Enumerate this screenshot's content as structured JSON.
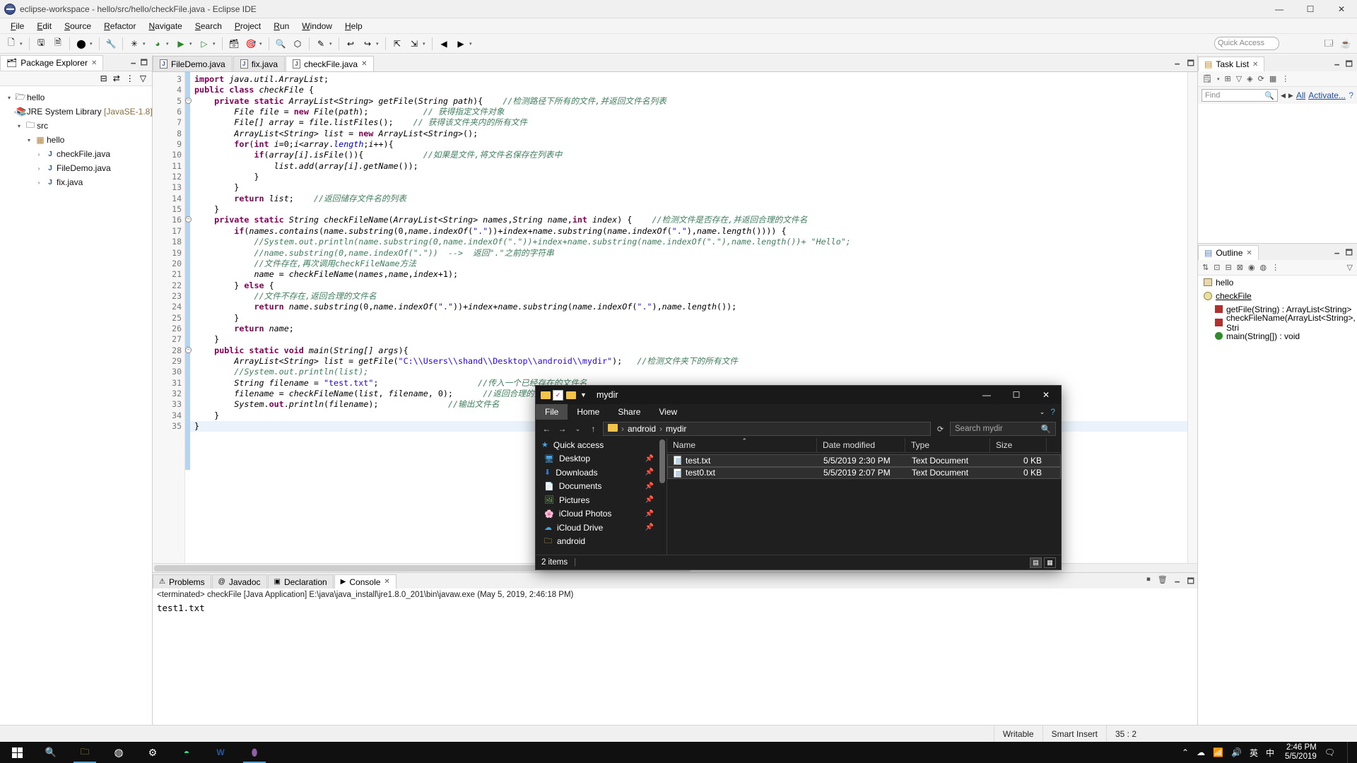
{
  "window": {
    "title": "eclipse-workspace - hello/src/hello/checkFile.java - Eclipse IDE",
    "minimize": "—",
    "maximize": "☐",
    "close": "✕"
  },
  "menubar": {
    "items": [
      "File",
      "Edit",
      "Source",
      "Refactor",
      "Navigate",
      "Search",
      "Project",
      "Run",
      "Window",
      "Help"
    ]
  },
  "toolbar": {
    "quick_access_placeholder": "Quick Access"
  },
  "package_explorer": {
    "title": "Package Explorer",
    "tree": [
      {
        "indent": 0,
        "twist": "▾",
        "icon": "project-icon",
        "label": "hello",
        "dim": ""
      },
      {
        "indent": 1,
        "twist": "›",
        "icon": "library-icon",
        "label": "JRE System Library",
        "dim": " [JavaSE-1.8]"
      },
      {
        "indent": 1,
        "twist": "▾",
        "icon": "source-folder-icon",
        "label": "src",
        "dim": ""
      },
      {
        "indent": 2,
        "twist": "▾",
        "icon": "package-icon",
        "label": "hello",
        "dim": ""
      },
      {
        "indent": 3,
        "twist": "›",
        "icon": "java-file-icon",
        "label": "checkFile.java",
        "dim": ""
      },
      {
        "indent": 3,
        "twist": "›",
        "icon": "java-file-icon",
        "label": "FileDemo.java",
        "dim": ""
      },
      {
        "indent": 3,
        "twist": "›",
        "icon": "java-file-icon",
        "label": "fix.java",
        "dim": ""
      }
    ]
  },
  "editor": {
    "tabs": [
      {
        "label": "FileDemo.java",
        "active": false,
        "closable": false
      },
      {
        "label": "fix.java",
        "active": false,
        "closable": false
      },
      {
        "label": "checkFile.java",
        "active": true,
        "closable": true
      }
    ],
    "first_line": 3,
    "last_line": 35,
    "lines": [
      {
        "n": 3,
        "fold": false,
        "html": "<span class=\"kw\">import</span> <span class=\"ty\">java.util.ArrayList</span>;"
      },
      {
        "n": 4,
        "fold": false,
        "html": "<span class=\"kw\">public class</span> <span class=\"ty\">checkFile</span> {"
      },
      {
        "n": 5,
        "fold": true,
        "html": "    <span class=\"kw\">private static</span> <span class=\"ty\">ArrayList&lt;String&gt; getFile</span>(<span class=\"ty\">String path</span>){    <span class=\"cmt\">//检测路径下所有的文件,并返回文件名列表</span>"
      },
      {
        "n": 6,
        "fold": false,
        "html": "        <span class=\"ty\">File file</span> = <span class=\"kw\">new</span> <span class=\"ty\">File</span>(<span class=\"id\">path</span>);           <span class=\"cmt\">// 获得指定文件对象</span>"
      },
      {
        "n": 7,
        "fold": false,
        "html": "        <span class=\"ty\">File[] array</span> = <span class=\"ty\">file.listFiles</span>();    <span class=\"cmt\">// 获得该文件夹内的所有文件</span>"
      },
      {
        "n": 8,
        "fold": false,
        "html": "        <span class=\"ty\">ArrayList&lt;String&gt; list</span> = <span class=\"kw\">new</span> <span class=\"ty\">ArrayList&lt;String&gt;</span>();"
      },
      {
        "n": 9,
        "fold": false,
        "html": "        <span class=\"kw\">for</span>(<span class=\"kw\">int</span> <span class=\"ty\">i</span>=0;<span class=\"ty\">i</span>&lt;<span class=\"ty\">array</span>.<span class=\"fld\">length</span>;<span class=\"ty\">i</span>++){"
      },
      {
        "n": 10,
        "fold": false,
        "html": "            <span class=\"kw\">if</span>(<span class=\"ty\">array[i].isFile</span>()){            <span class=\"cmt\">//如果是文件,将文件名保存在列表中</span>"
      },
      {
        "n": 11,
        "fold": false,
        "html": "                <span class=\"ty\">list.add</span>(<span class=\"ty\">array[i].getName</span>());"
      },
      {
        "n": 12,
        "fold": false,
        "html": "            }"
      },
      {
        "n": 13,
        "fold": false,
        "html": "        }"
      },
      {
        "n": 14,
        "fold": false,
        "html": "        <span class=\"kw\">return</span> <span class=\"ty\">list</span>;    <span class=\"cmt\">//返回储存文件名的列表</span>"
      },
      {
        "n": 15,
        "fold": false,
        "html": "    }"
      },
      {
        "n": 16,
        "fold": true,
        "html": "    <span class=\"kw\">private static</span> <span class=\"ty\">String checkFileName</span>(<span class=\"ty\">ArrayList&lt;String&gt; names</span>,<span class=\"ty\">String name</span>,<span class=\"kw\">int</span> <span class=\"ty\">index</span>) {    <span class=\"cmt\">//检测文件是否存在,并返回合理的文件名</span>"
      },
      {
        "n": 17,
        "fold": false,
        "html": "        <span class=\"kw\">if</span>(<span class=\"ty\">names.contains</span>(<span class=\"ty\">name.substring</span>(0,<span class=\"ty\">name.indexOf</span>(<span class=\"str\">\".\"</span>))+<span class=\"ty\">index</span>+<span class=\"ty\">name.substring</span>(<span class=\"ty\">name.indexOf</span>(<span class=\"str\">\".\"</span>),<span class=\"ty\">name.length</span>()))) {"
      },
      {
        "n": 18,
        "fold": false,
        "html": "            <span class=\"cmt\">//System.out.println(name.substring(0,name.indexOf(\".\"))+index+name.substring(name.indexOf(\".\"),name.length())+ \"Hello\";</span>"
      },
      {
        "n": 19,
        "fold": false,
        "html": "            <span class=\"cmt\">//name.substring(0,name.indexOf(\".\"))  --&gt;  返回\".\"之前的字符串</span>"
      },
      {
        "n": 20,
        "fold": false,
        "html": "            <span class=\"cmt\">//文件存在,再次调用checkFileName方法</span>"
      },
      {
        "n": 21,
        "fold": false,
        "html": "            <span class=\"ty\">name</span> = <span class=\"ty\">checkFileName</span>(<span class=\"ty\">names</span>,<span class=\"ty\">name</span>,<span class=\"ty\">index</span>+1);"
      },
      {
        "n": 22,
        "fold": false,
        "html": "        } <span class=\"kw\">else</span> {"
      },
      {
        "n": 23,
        "fold": false,
        "html": "            <span class=\"cmt\">//文件不存在,返回合理的文件名</span>"
      },
      {
        "n": 24,
        "fold": false,
        "html": "            <span class=\"kw\">return</span> <span class=\"ty\">name.substring</span>(0,<span class=\"ty\">name.indexOf</span>(<span class=\"str\">\".\"</span>))+<span class=\"ty\">index</span>+<span class=\"ty\">name.substring</span>(<span class=\"ty\">name.indexOf</span>(<span class=\"str\">\".\"</span>),<span class=\"ty\">name.length</span>());"
      },
      {
        "n": 25,
        "fold": false,
        "html": "        }"
      },
      {
        "n": 26,
        "fold": false,
        "html": "        <span class=\"kw\">return</span> <span class=\"ty\">name</span>;"
      },
      {
        "n": 27,
        "fold": false,
        "html": "    }"
      },
      {
        "n": 28,
        "fold": true,
        "html": "    <span class=\"kw\">public static void</span> <span class=\"ty\">main</span>(<span class=\"ty\">String[] args</span>){"
      },
      {
        "n": 29,
        "fold": false,
        "html": "        <span class=\"ty\">ArrayList&lt;String&gt; list</span> = <span class=\"ty\">getFile</span>(<span class=\"str\">\"C:\\\\Users\\\\shand\\\\Desktop\\\\android\\\\mydir\"</span>);   <span class=\"cmt\">//检测文件夹下的所有文件</span>"
      },
      {
        "n": 30,
        "fold": false,
        "html": "        <span class=\"cmt\">//System.out.println(list);</span>"
      },
      {
        "n": 31,
        "fold": false,
        "html": "        <span class=\"ty\">String filename</span> = <span class=\"str\">\"test.txt\"</span>;                    <span class=\"cmt\">//传入一个已经存在的文件名</span>"
      },
      {
        "n": 32,
        "fold": false,
        "html": "        <span class=\"ty\">filename</span> = <span class=\"ty\">checkFileName</span>(<span class=\"ty\">list</span>, <span class=\"ty\">filename</span>, 0);      <span class=\"cmt\">//返回合理的文件名</span>"
      },
      {
        "n": 33,
        "fold": false,
        "html": "        <span class=\"ty\">System</span>.<span class=\"kw\">out</span>.<span class=\"ty\">println</span>(<span class=\"ty\">filename</span>);              <span class=\"cmt\">//输出文件名</span>"
      },
      {
        "n": 34,
        "fold": false,
        "html": "    }"
      },
      {
        "n": 35,
        "fold": false,
        "html": "}"
      }
    ]
  },
  "bottom_view": {
    "tabs": [
      {
        "label": "Problems",
        "active": false
      },
      {
        "label": "Javadoc",
        "active": false
      },
      {
        "label": "Declaration",
        "active": false
      },
      {
        "label": "Console",
        "active": true
      }
    ],
    "console_header": "<terminated> checkFile [Java Application] E:\\java\\java_install\\jre1.8.0_201\\bin\\javaw.exe (May 5, 2019, 2:46:18 PM)",
    "console_output": "test1.txt"
  },
  "task_list": {
    "title": "Task List",
    "find_placeholder": "Find",
    "filter_all": "All",
    "activate": "Activate..."
  },
  "outline": {
    "title": "Outline",
    "items": [
      {
        "icon": "package-icon",
        "label": "hello",
        "indent": 0
      },
      {
        "icon": "class-icon",
        "label": "checkFile",
        "indent": 0
      },
      {
        "icon": "private-method-icon",
        "label": "getFile(String) : ArrayList<String>",
        "indent": 1
      },
      {
        "icon": "private-method-icon",
        "label": "checkFileName(ArrayList<String>, Stri",
        "indent": 1
      },
      {
        "icon": "public-method-icon",
        "label": "main(String[]) : void",
        "indent": 1
      }
    ]
  },
  "statusbar": {
    "writable": "Writable",
    "insert_mode": "Smart Insert",
    "cursor": "35 : 2"
  },
  "explorer": {
    "title": "mydir",
    "minimize": "—",
    "maximize": "☐",
    "close": "✕",
    "ribbon_tabs": [
      "File",
      "Home",
      "Share",
      "View"
    ],
    "address_path": [
      "android",
      "mydir"
    ],
    "search_placeholder": "Search mydir",
    "sidebar": [
      {
        "label": "Quick access",
        "icon": "star-icon",
        "pinned": false
      },
      {
        "label": "Desktop",
        "icon": "desktop-icon",
        "pinned": true
      },
      {
        "label": "Downloads",
        "icon": "download-icon",
        "pinned": true
      },
      {
        "label": "Documents",
        "icon": "documents-icon",
        "pinned": true
      },
      {
        "label": "Pictures",
        "icon": "pictures-icon",
        "pinned": true
      },
      {
        "label": "iCloud Photos",
        "icon": "icloud-photos-icon",
        "pinned": true
      },
      {
        "label": "iCloud Drive",
        "icon": "icloud-drive-icon",
        "pinned": true
      },
      {
        "label": "android",
        "icon": "folder-icon",
        "pinned": false
      }
    ],
    "columns": [
      "Name",
      "Date modified",
      "Type",
      "Size"
    ],
    "files": [
      {
        "name": "test.txt",
        "date": "5/5/2019 2:30 PM",
        "type": "Text Document",
        "size": "0 KB"
      },
      {
        "name": "test0.txt",
        "date": "5/5/2019 2:07 PM",
        "type": "Text Document",
        "size": "0 KB"
      }
    ],
    "status": "2 items"
  },
  "taskbar": {
    "apps": [
      "file-explorer-icon",
      "chrome-icon",
      "settings-icon",
      "android-studio-icon",
      "word-icon",
      "eclipse-icon"
    ],
    "tray": [
      "chevron-up-icon",
      "onedrive-icon",
      "network-icon",
      "volume-icon"
    ],
    "ime": "英",
    "ime2": "中",
    "time": "2:46 PM",
    "date": "5/5/2019"
  }
}
